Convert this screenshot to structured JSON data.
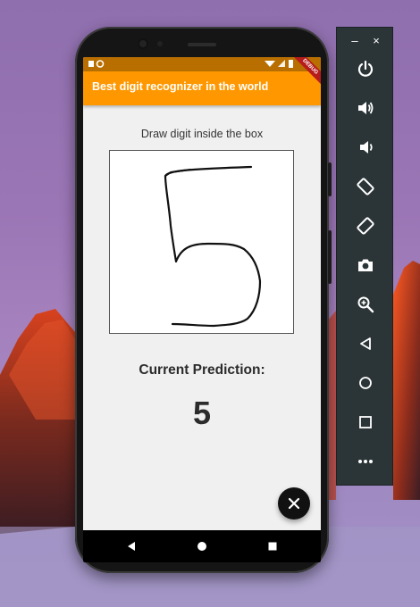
{
  "app": {
    "title": "Best digit recognizer in the world",
    "debug_banner": "DEBUG",
    "accent_color": "#ff9800",
    "status_bar_color": "#b86f00"
  },
  "main": {
    "instruction": "Draw digit inside the box",
    "prediction_label": "Current Prediction:",
    "prediction_value": "5"
  },
  "fab": {
    "icon": "close-icon"
  },
  "nav_bar": {
    "buttons": [
      "back-icon",
      "home-icon",
      "recents-icon"
    ]
  },
  "emulator_toolbar": {
    "window_controls": [
      {
        "name": "minimize",
        "label": "–"
      },
      {
        "name": "close",
        "label": "×"
      }
    ],
    "buttons": [
      "power-icon",
      "volume-up-icon",
      "volume-down-icon",
      "rotate-left-icon",
      "rotate-right-icon",
      "camera-icon",
      "zoom-icon",
      "back-icon",
      "home-icon",
      "overview-icon",
      "more-icon"
    ]
  }
}
